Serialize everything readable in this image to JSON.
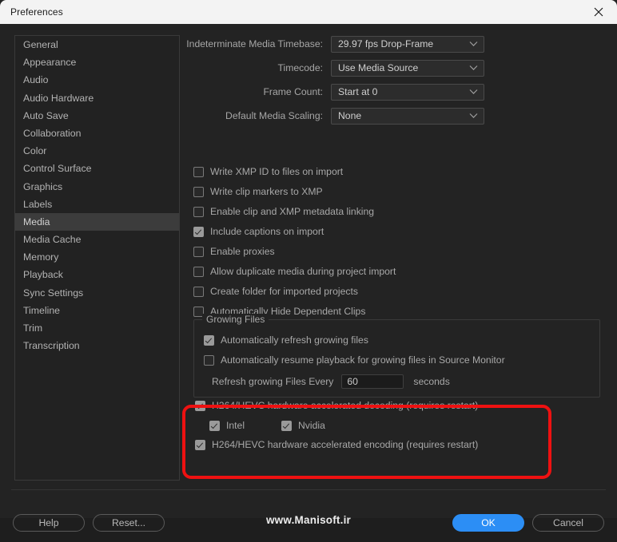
{
  "window": {
    "title": "Preferences",
    "close_icon": "close-icon"
  },
  "sidebar": {
    "items": [
      {
        "label": "General",
        "selected": false
      },
      {
        "label": "Appearance",
        "selected": false
      },
      {
        "label": "Audio",
        "selected": false
      },
      {
        "label": "Audio Hardware",
        "selected": false
      },
      {
        "label": "Auto Save",
        "selected": false
      },
      {
        "label": "Collaboration",
        "selected": false
      },
      {
        "label": "Color",
        "selected": false
      },
      {
        "label": "Control Surface",
        "selected": false
      },
      {
        "label": "Graphics",
        "selected": false
      },
      {
        "label": "Labels",
        "selected": false
      },
      {
        "label": "Media",
        "selected": true
      },
      {
        "label": "Media Cache",
        "selected": false
      },
      {
        "label": "Memory",
        "selected": false
      },
      {
        "label": "Playback",
        "selected": false
      },
      {
        "label": "Sync Settings",
        "selected": false
      },
      {
        "label": "Timeline",
        "selected": false
      },
      {
        "label": "Trim",
        "selected": false
      },
      {
        "label": "Transcription",
        "selected": false
      }
    ]
  },
  "media": {
    "dropdowns": [
      {
        "label": "Indeterminate Media Timebase:",
        "value": "29.97 fps Drop-Frame"
      },
      {
        "label": "Timecode:",
        "value": "Use Media Source"
      },
      {
        "label": "Frame Count:",
        "value": "Start at 0"
      },
      {
        "label": "Default Media Scaling:",
        "value": "None"
      }
    ],
    "checkboxes": [
      {
        "label": "Write XMP ID to files on import",
        "checked": false
      },
      {
        "label": "Write clip markers to XMP",
        "checked": false
      },
      {
        "label": "Enable clip and XMP metadata linking",
        "checked": false
      },
      {
        "label": "Include captions on import",
        "checked": true
      },
      {
        "label": "Enable proxies",
        "checked": false
      },
      {
        "label": "Allow duplicate media during project import",
        "checked": false
      },
      {
        "label": "Create folder for imported projects",
        "checked": false
      },
      {
        "label": "Automatically Hide Dependent Clips",
        "checked": false
      }
    ],
    "growing_files": {
      "title": "Growing Files",
      "checkboxes": [
        {
          "label": "Automatically refresh growing files",
          "checked": true
        },
        {
          "label": "Automatically resume playback for growing files in Source Monitor",
          "checked": false
        }
      ],
      "refresh_label": "Refresh growing Files Every",
      "refresh_value": "60",
      "refresh_placeholder": "60",
      "seconds_label": "seconds"
    },
    "hardware": [
      {
        "label": "H264/HEVC hardware accelerated decoding (requires restart)",
        "checked": true
      },
      {
        "label": "Intel",
        "checked": true
      },
      {
        "label": "Nvidia",
        "checked": true
      },
      {
        "label": "H264/HEVC hardware accelerated encoding (requires restart)",
        "checked": true
      }
    ],
    "highlight_color": "#ee1111"
  },
  "footer": {
    "help_label": "Help",
    "reset_label": "Reset...",
    "ok_label": "OK",
    "cancel_label": "Cancel",
    "watermark": "www.Manisoft.ir",
    "primary_color": "#2c8ef5"
  }
}
